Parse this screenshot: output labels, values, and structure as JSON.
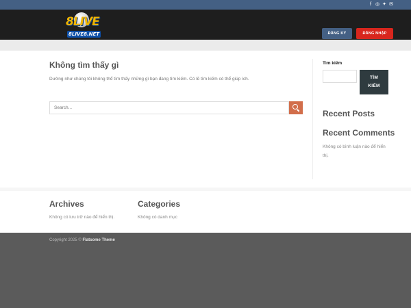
{
  "topbar": {
    "social": [
      {
        "icon": "facebook-icon",
        "glyph": "f"
      },
      {
        "icon": "instagram-icon",
        "glyph": "◎"
      },
      {
        "icon": "twitter-icon",
        "glyph": "✦"
      },
      {
        "icon": "email-icon",
        "glyph": "✉"
      }
    ]
  },
  "header": {
    "logo_main": "8LIVE",
    "logo_site": "8LIVE8.NET",
    "register_label": "ĐĂNG KÝ",
    "login_label": "ĐĂNG NHẬP"
  },
  "main": {
    "title": "Không tìm thấy gì",
    "message": "Dường như chúng tôi không thể tìm thấy những gì bạn đang tìm kiếm. Có lẽ tìm kiếm có thể giúp ích.",
    "search_placeholder": "Search..."
  },
  "sidebar": {
    "search_label": "Tìm kiếm",
    "search_button_line1": "TÌM",
    "search_button_line2": "KIẾM",
    "recent_posts_title": "Recent Posts",
    "recent_comments_title": "Recent Comments",
    "no_comments": "Không có bình luận nào để hiển thị."
  },
  "footer_widgets": {
    "archives_title": "Archives",
    "archives_text": "Không có lưu trữ nào để hiển thị.",
    "categories_title": "Categories",
    "categories_text": "Không có danh mục"
  },
  "footer": {
    "copyright_prefix": "Copyright 2025 ©",
    "copyright_theme": "Flatsome Theme"
  },
  "colors": {
    "topbar": "#446084",
    "header": "#1e1e1e",
    "register": "#446084",
    "login": "#d8261d",
    "search_accent": "#d26e4b",
    "footer_bg": "#5b5b5b"
  }
}
